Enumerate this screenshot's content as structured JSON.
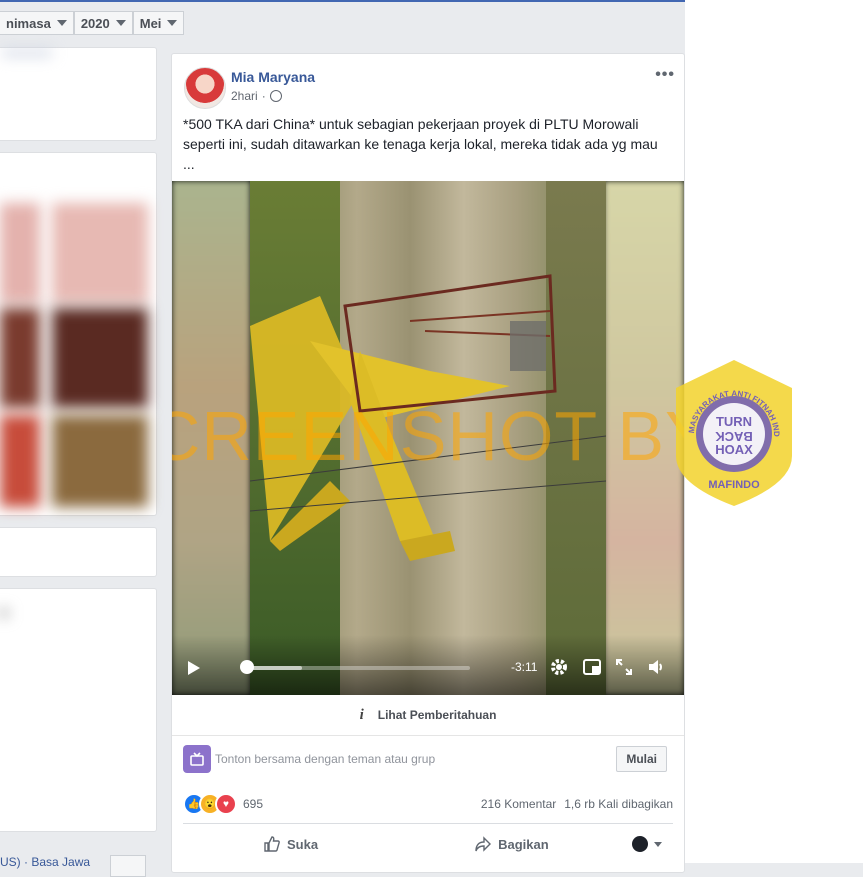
{
  "filters": {
    "category": "nimasa",
    "year": "2020",
    "month": "Mei"
  },
  "post": {
    "author": "Mia Maryana",
    "time": "2hari",
    "text": "*500 TKA dari China* untuk sebagian pekerjaan proyek di PLTU Morowali seperti ini, sudah ditawarkan ke tenaga kerja lokal, mereka tidak ada yg mau ...",
    "more_icon": "•••",
    "video": {
      "time_remaining": "-3:11",
      "progress": 0.02,
      "watermark": "SCREENSHOT BY"
    },
    "notice_label": "Lihat Pemberitahuan",
    "watch_together": "Tonton bersama dengan teman atau grup",
    "start_label": "Mulai",
    "reactions_count": "695",
    "comments": "216 Komentar",
    "shares": "1,6 rb Kali dibagikan",
    "like_label": "Suka",
    "share_label": "Bagikan"
  },
  "sidebar_bottom": {
    "text": "US) · Basa Jawa"
  },
  "badge": {
    "ring_text": "MASYARAKAT ANTI FITNAH INDONESIA",
    "center_top": "TURN",
    "center_mid": "BACK",
    "center_bottom": "HOAX",
    "name": "MAFINDO"
  },
  "colors": {
    "accent": "#4267b2",
    "link": "#385898",
    "badge_yellow": "#f2d22c",
    "badge_purple": "#7460b6"
  }
}
